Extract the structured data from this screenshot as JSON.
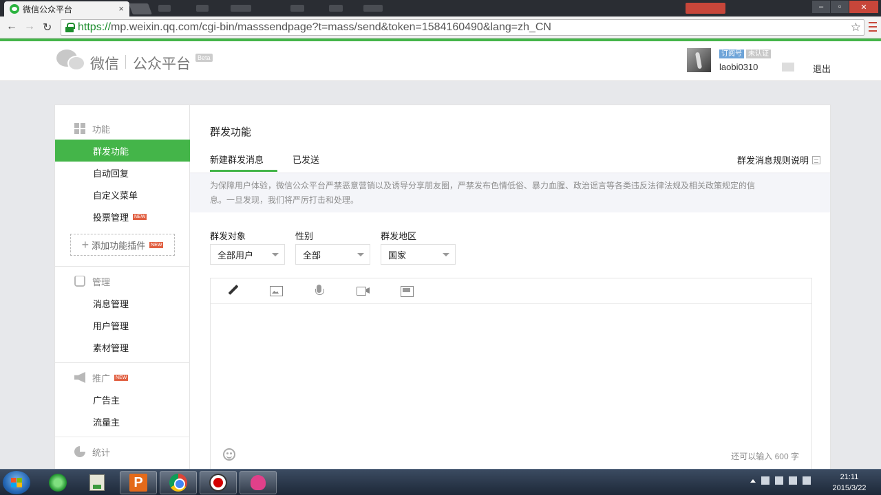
{
  "browser": {
    "tab_title": "微信公众平台",
    "tab_close": "×",
    "url_scheme": "https://",
    "url_rest": "mp.weixin.qq.com/cgi-bin/masssendpage?t=mass/send&token=1584160490&lang=zh_CN",
    "back": "←",
    "forward": "→",
    "reload": "↻",
    "star": "☆",
    "win_min": "–",
    "win_max": "▫",
    "win_close": "✕"
  },
  "header": {
    "logo_word": "微信",
    "logo_platform": "公众平台",
    "logo_beta": "Beta",
    "badge_subscription": "订阅号",
    "badge_unverified": "未认证",
    "username": "laobi0310",
    "logout": "退出"
  },
  "sidebar": {
    "sections": [
      {
        "label": "功能",
        "icon": "grid-icon"
      },
      {
        "label": "管理",
        "icon": "tray-icon"
      },
      {
        "label": "推广",
        "icon": "megaphone-icon"
      },
      {
        "label": "统计",
        "icon": "pie-chart-icon"
      }
    ],
    "items": [
      {
        "label": "群发功能"
      },
      {
        "label": "自动回复"
      },
      {
        "label": "自定义菜单"
      },
      {
        "label": "投票管理"
      },
      {
        "label": "消息管理"
      },
      {
        "label": "用户管理"
      },
      {
        "label": "素材管理"
      },
      {
        "label": "广告主"
      },
      {
        "label": "流量主"
      }
    ],
    "new_tag": "NEW",
    "add_plugin": "添加功能插件",
    "add_plus": "+"
  },
  "main": {
    "title": "群发功能",
    "tabs": [
      {
        "label": "新建群发消息"
      },
      {
        "label": "已发送"
      }
    ],
    "rules_link": "群发消息规则说明",
    "notice_line1": "为保障用户体验，微信公众平台严禁恶意营销以及诱导分享朋友圈，严禁发布色情低俗、暴力血腥、政治谣言等各类违反法律法规及相关政策规定的信",
    "notice_line2": "息。一旦发现，我们将严厉打击和处理。",
    "filters": [
      {
        "label": "群发对象",
        "value": "全部用户"
      },
      {
        "label": "性别",
        "value": "全部"
      },
      {
        "label": "群发地区",
        "value": "国家"
      }
    ],
    "editor": {
      "tools": [
        "pencil-icon",
        "image-icon",
        "microphone-icon",
        "video-icon",
        "news-icon"
      ],
      "char_count": "还可以输入 600 字"
    }
  },
  "taskbar": {
    "time": "21:11",
    "date": "2015/3/22",
    "ppt_letter": "P"
  },
  "colors": {
    "accent_green": "#44b549",
    "tag_red": "#e15f41"
  }
}
